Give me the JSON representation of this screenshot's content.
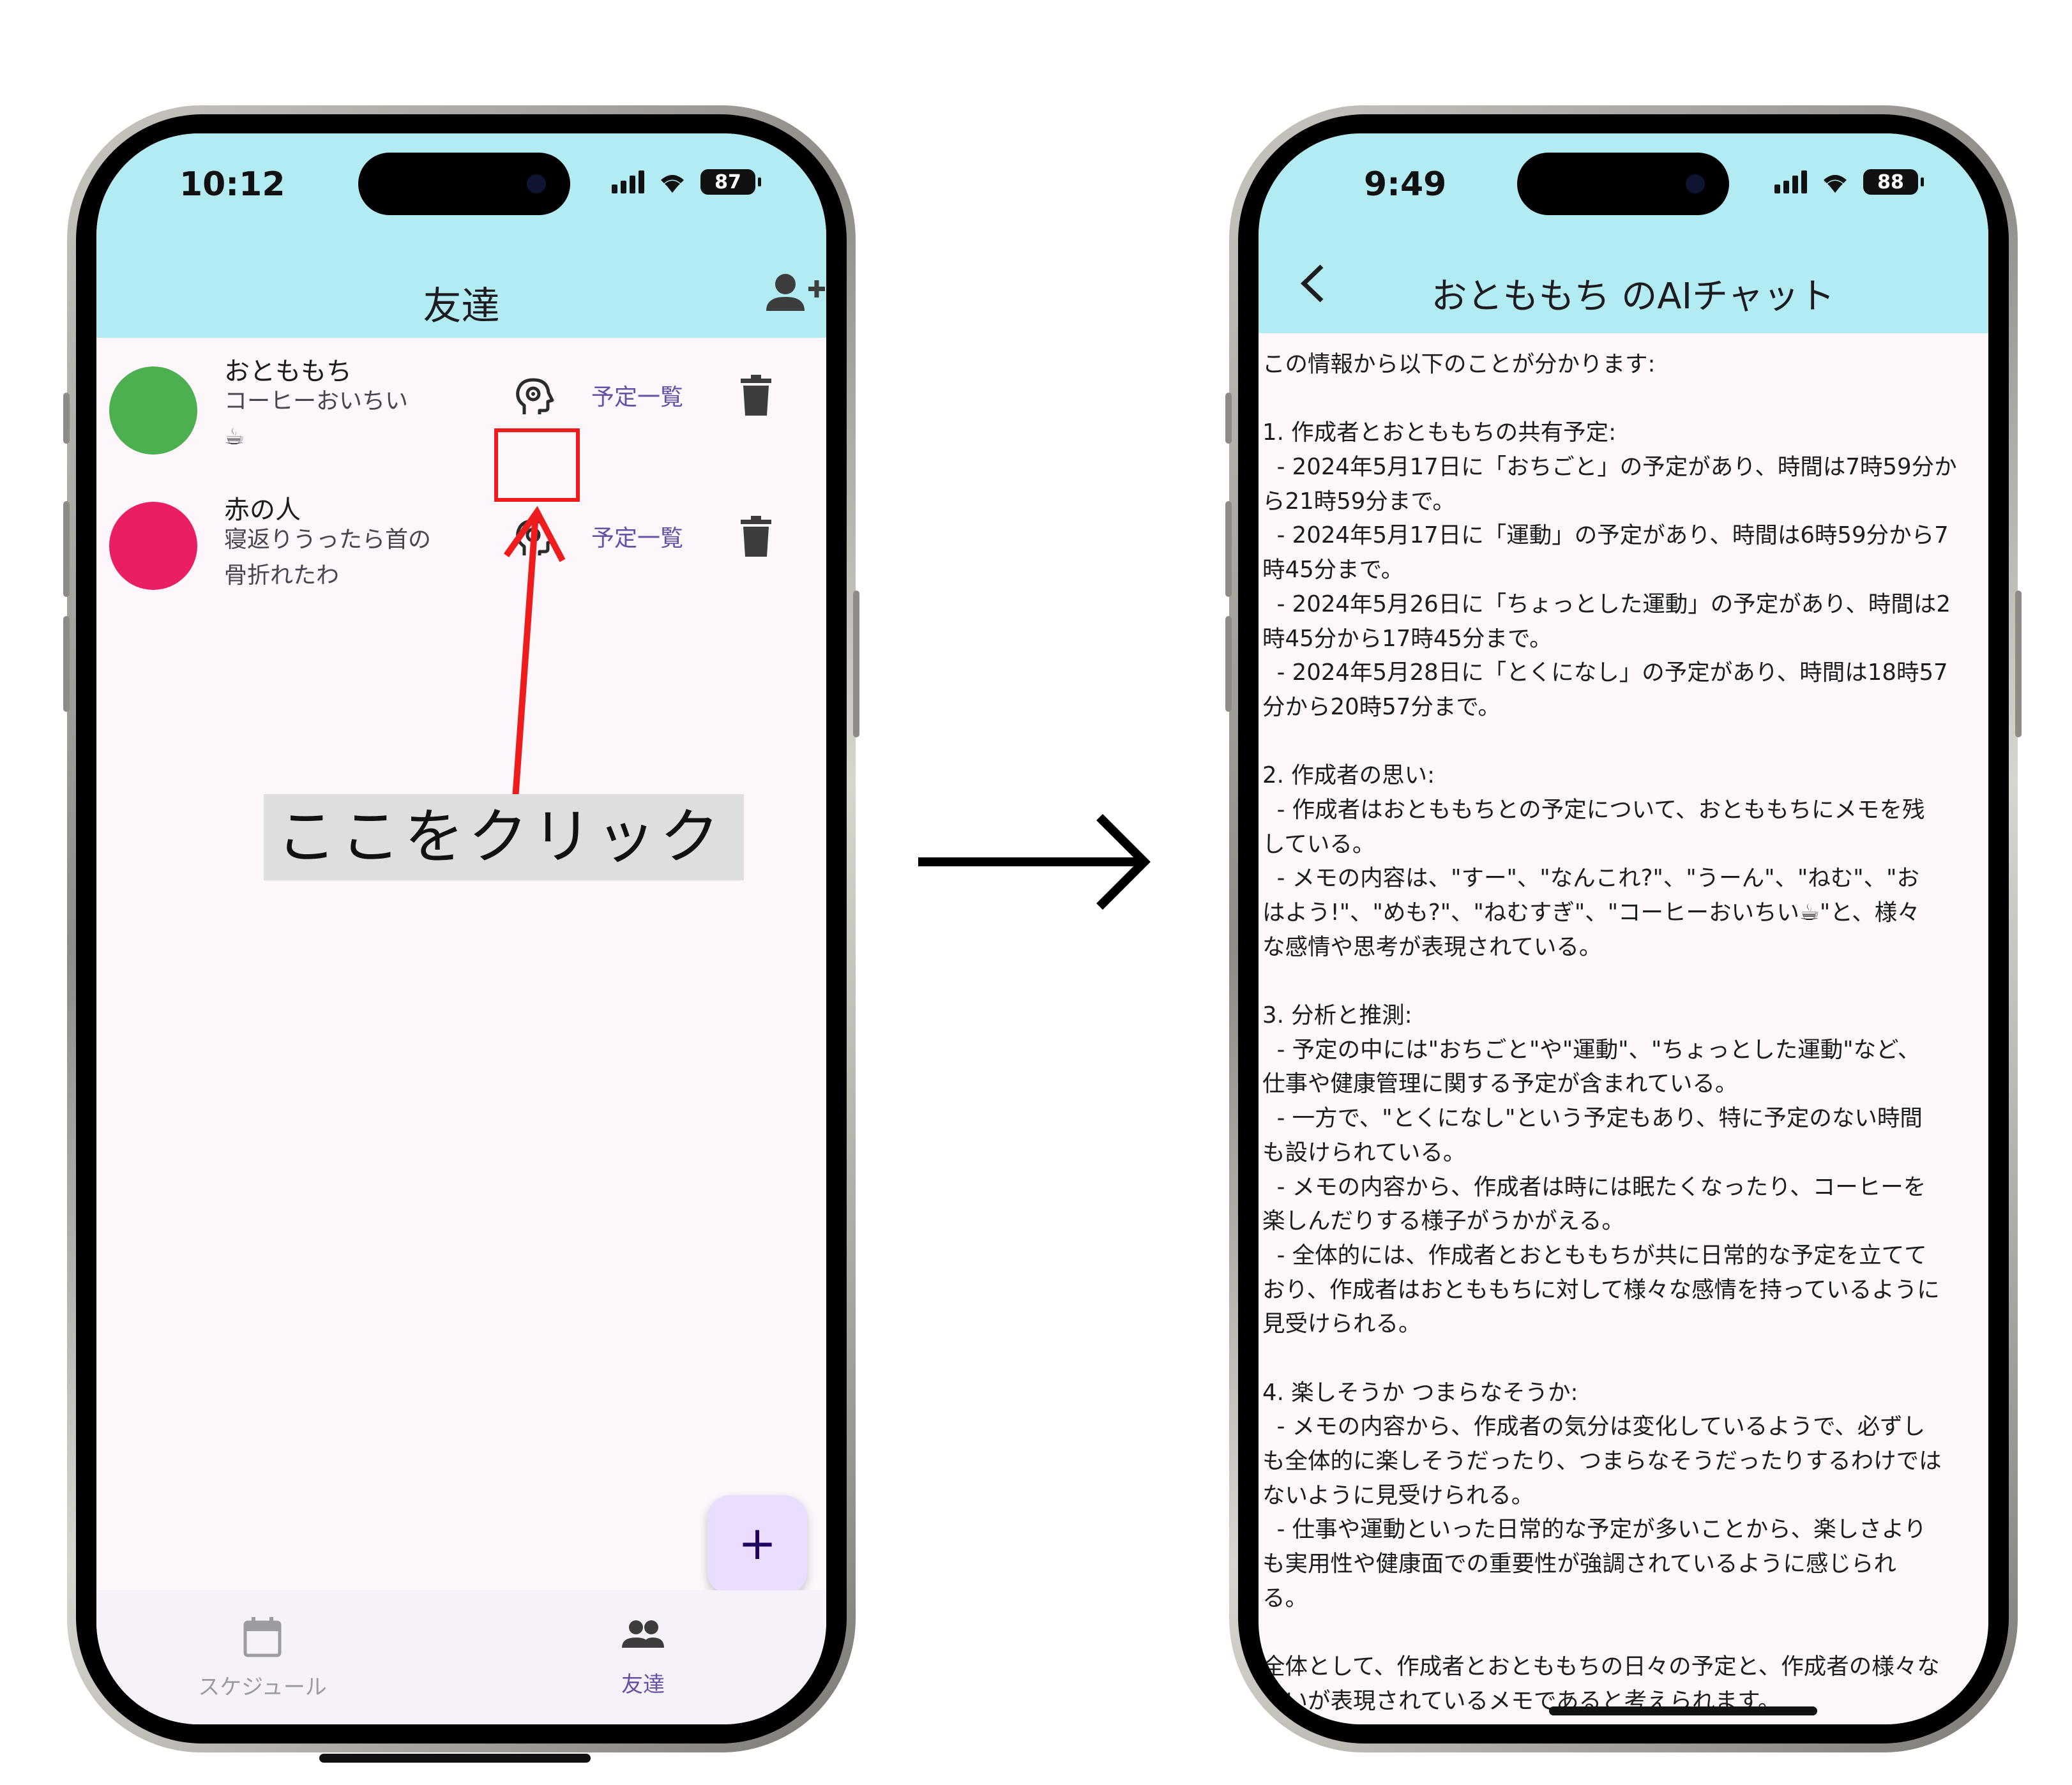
{
  "left_phone": {
    "status": {
      "time": "10:12",
      "battery": "87"
    },
    "appbar": {
      "title": "友達",
      "add_friend_icon": "person-add-icon"
    },
    "friends": [
      {
        "name": "おとももち",
        "memo_lines": [
          "コーヒーおいちい",
          "☕"
        ],
        "avatar_color": "#4caf50",
        "ai_icon": "psychology-icon",
        "schedule_link": "予定一覧",
        "delete_icon": "trash-icon"
      },
      {
        "name": "赤の人",
        "memo_lines": [
          "寝返りうったら首の",
          "骨折れたわ"
        ],
        "avatar_color": "#e91e63",
        "ai_icon": "psychology-icon",
        "schedule_link": "予定一覧",
        "delete_icon": "trash-icon"
      }
    ],
    "callout": "ここをクリック",
    "fab": "+",
    "bottom_nav": [
      {
        "label": "スケジュール",
        "icon": "calendar-icon",
        "active": false
      },
      {
        "label": "友達",
        "icon": "people-icon",
        "active": true
      }
    ]
  },
  "right_phone": {
    "status": {
      "time": "9:49",
      "battery": "88"
    },
    "appbar": {
      "title": "おとももち のAIチャット",
      "back_icon": "chevron-left-icon"
    },
    "chat_lines": [
      "この情報から以下のことが分かります:",
      "",
      "1. 作成者とおとももちの共有予定:",
      "  - 2024年5月17日に「おちごと」の予定があり、時間は7時59分か",
      "ら21時59分まで。",
      "  - 2024年5月17日に「運動」の予定があり、時間は6時59分から7",
      "時45分まで。",
      "  - 2024年5月26日に「ちょっとした運動」の予定があり、時間は2",
      "時45分から17時45分まで。",
      "  - 2024年5月28日に「とくになし」の予定があり、時間は18時57",
      "分から20時57分まで。",
      "",
      "2. 作成者の思い:",
      "  - 作成者はおとももちとの予定について、おとももちにメモを残",
      "している。",
      "  - メモの内容は、\"すー\"、\"なんこれ?\"、\"うーん\"、\"ねむ\"、\"お",
      "はよう!\"、\"めも?\"、\"ねむすぎ\"、\"コーヒーおいちい☕\"と、様々",
      "な感情や思考が表現されている。",
      "",
      "3. 分析と推測:",
      "  - 予定の中には\"おちごと\"や\"運動\"、\"ちょっとした運動\"など、",
      "仕事や健康管理に関する予定が含まれている。",
      "  - 一方で、\"とくになし\"という予定もあり、特に予定のない時間",
      "も設けられている。",
      "  - メモの内容から、作成者は時には眠たくなったり、コーヒーを",
      "楽しんだりする様子がうかがえる。",
      "  - 全体的には、作成者とおとももちが共に日常的な予定を立てて",
      "おり、作成者はおとももちに対して様々な感情を持っているように",
      "見受けられる。",
      "",
      "4. 楽しそうか つまらなそうか:",
      "  - メモの内容から、作成者の気分は変化しているようで、必ずし",
      "も全体的に楽しそうだったり、つまらなそうだったりするわけでは",
      "ないように見受けられる。",
      "  - 仕事や運動といった日常的な予定が多いことから、楽しさより",
      "も実用性や健康面での重要性が強調されているように感じられ",
      "る。",
      "",
      "全体として、作成者とおとももちの日々の予定と、作成者の様々な",
      "思いが表現されているメモであると考えられます。"
    ]
  }
}
